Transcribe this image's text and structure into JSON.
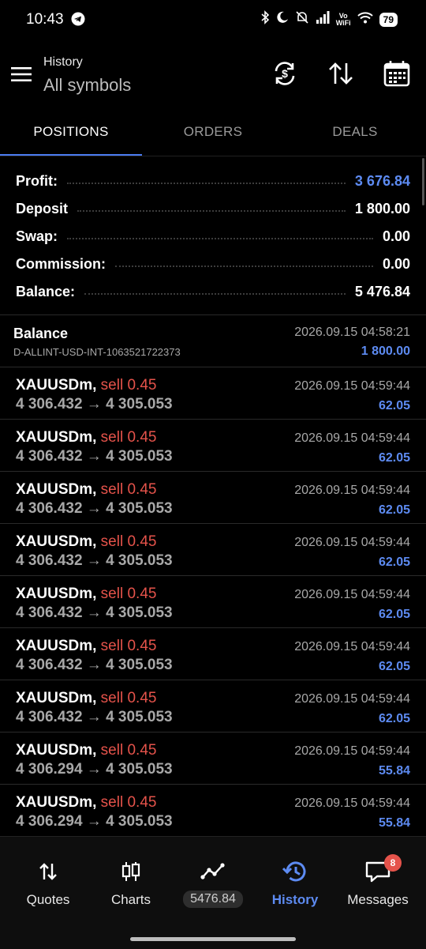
{
  "status": {
    "time": "10:43",
    "volte": "Vo\nWiFi",
    "battery": "79"
  },
  "header": {
    "subtitle": "History",
    "title": "All symbols"
  },
  "tabs": [
    "POSITIONS",
    "ORDERS",
    "DEALS"
  ],
  "summary": [
    {
      "label": "Profit:",
      "value": "3 676.84",
      "highlight": true
    },
    {
      "label": "Deposit",
      "value": "1 800.00",
      "highlight": false
    },
    {
      "label": "Swap:",
      "value": "0.00",
      "highlight": false
    },
    {
      "label": "Commission:",
      "value": "0.00",
      "highlight": false
    },
    {
      "label": "Balance:",
      "value": "5 476.84",
      "highlight": false
    }
  ],
  "balance_entry": {
    "title": "Balance",
    "id": "D-ALLINT-USD-INT-1063521722373",
    "time": "2026.09.15 04:58:21",
    "amount": "1 800.00"
  },
  "deals": [
    {
      "symbol": "XAUUSDm,",
      "side": " sell 0.45",
      "prices": "4 306.432 → 4 305.053",
      "time": "2026.09.15 04:59:44",
      "profit": "62.05"
    },
    {
      "symbol": "XAUUSDm,",
      "side": " sell 0.45",
      "prices": "4 306.432 → 4 305.053",
      "time": "2026.09.15 04:59:44",
      "profit": "62.05"
    },
    {
      "symbol": "XAUUSDm,",
      "side": " sell 0.45",
      "prices": "4 306.432 → 4 305.053",
      "time": "2026.09.15 04:59:44",
      "profit": "62.05"
    },
    {
      "symbol": "XAUUSDm,",
      "side": " sell 0.45",
      "prices": "4 306.432 → 4 305.053",
      "time": "2026.09.15 04:59:44",
      "profit": "62.05"
    },
    {
      "symbol": "XAUUSDm,",
      "side": " sell 0.45",
      "prices": "4 306.432 → 4 305.053",
      "time": "2026.09.15 04:59:44",
      "profit": "62.05"
    },
    {
      "symbol": "XAUUSDm,",
      "side": " sell 0.45",
      "prices": "4 306.432 → 4 305.053",
      "time": "2026.09.15 04:59:44",
      "profit": "62.05"
    },
    {
      "symbol": "XAUUSDm,",
      "side": " sell 0.45",
      "prices": "4 306.432 → 4 305.053",
      "time": "2026.09.15 04:59:44",
      "profit": "62.05"
    },
    {
      "symbol": "XAUUSDm,",
      "side": " sell 0.45",
      "prices": "4 306.294 → 4 305.053",
      "time": "2026.09.15 04:59:44",
      "profit": "55.84"
    },
    {
      "symbol": "XAUUSDm,",
      "side": " sell 0.45",
      "prices": "4 306.294 → 4 305.053",
      "time": "2026.09.15 04:59:44",
      "profit": "55.84"
    }
  ],
  "nav": {
    "quotes": "Quotes",
    "charts": "Charts",
    "balance_pill": "5476.84",
    "history": "History",
    "messages": "Messages",
    "messages_badge": "8"
  },
  "colors": {
    "accent": "#5d8bf2",
    "sell": "#e5534b",
    "background": "#000000"
  }
}
